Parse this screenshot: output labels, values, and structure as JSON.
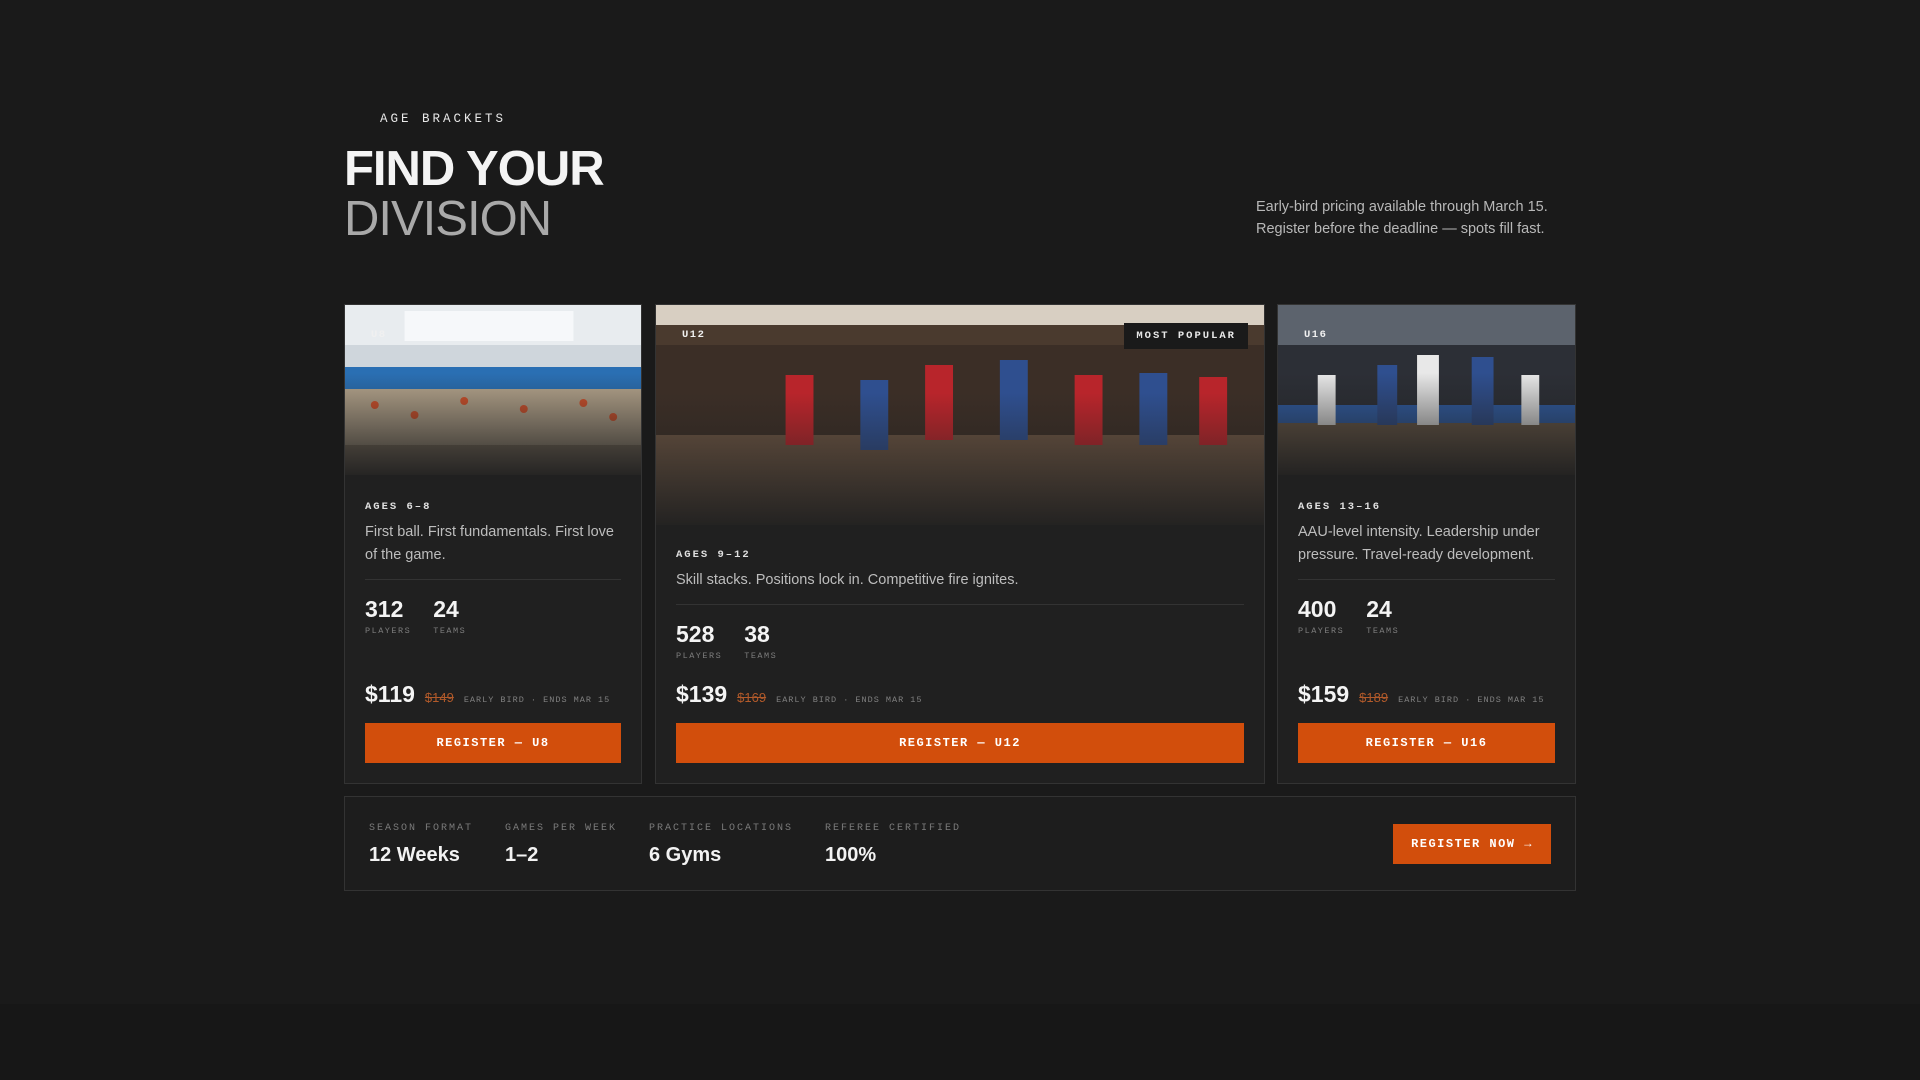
{
  "header": {
    "eyebrow": "AGE BRACKETS",
    "title_line1": "FIND YOUR",
    "title_line2": "DIVISION",
    "intro_line1": "Early-bird pricing available through March 15.",
    "intro_line2": "Register before the deadline — spots fill fast."
  },
  "cards": [
    {
      "tag": "U8",
      "ages": "AGES 6–8",
      "description": "First ball. First fundamentals. First love of the game.",
      "players_value": "312",
      "players_label": "PLAYERS",
      "teams_value": "24",
      "teams_label": "TEAMS",
      "price": "$119",
      "old_price": "$149",
      "early_bird": "EARLY BIRD · ENDS MAR 15",
      "button": "REGISTER — U8"
    },
    {
      "tag": "U12",
      "badge": "MOST POPULAR",
      "ages": "AGES 9–12",
      "description": "Skill stacks. Positions lock in. Competitive fire ignites.",
      "players_value": "528",
      "players_label": "PLAYERS",
      "teams_value": "38",
      "teams_label": "TEAMS",
      "price": "$139",
      "old_price": "$169",
      "early_bird": "EARLY BIRD · ENDS MAR 15",
      "button": "REGISTER — U12"
    },
    {
      "tag": "U16",
      "ages": "AGES 13–16",
      "description": "AAU-level intensity. Leadership under pressure. Travel-ready development.",
      "players_value": "400",
      "players_label": "PLAYERS",
      "teams_value": "24",
      "teams_label": "TEAMS",
      "price": "$159",
      "old_price": "$189",
      "early_bird": "EARLY BIRD · ENDS MAR 15",
      "button": "REGISTER — U16"
    }
  ],
  "infobar": {
    "items": [
      {
        "label": "SEASON FORMAT",
        "value": "12 Weeks"
      },
      {
        "label": "GAMES PER WEEK",
        "value": "1–2"
      },
      {
        "label": "PRACTICE LOCATIONS",
        "value": "6 Gyms"
      },
      {
        "label": "REFEREE CERTIFIED",
        "value": "100%"
      }
    ],
    "button": "REGISTER NOW →"
  },
  "colors": {
    "background": "#1a1a1a",
    "card": "#202020",
    "accent": "#d24e0c",
    "strike": "#b25a2a"
  }
}
